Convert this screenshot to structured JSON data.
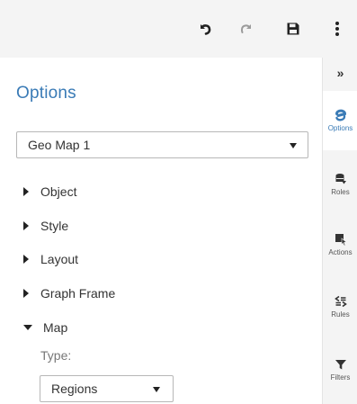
{
  "toolbar": {
    "undo_icon": "undo-icon",
    "redo_icon": "redo-icon",
    "save_icon": "save-icon",
    "more_icon": "more-vertical-icon"
  },
  "panel": {
    "title": "Options",
    "object_select": {
      "value": "Geo Map 1"
    },
    "sections": [
      {
        "label": "Object",
        "expanded": false
      },
      {
        "label": "Style",
        "expanded": false
      },
      {
        "label": "Layout",
        "expanded": false
      },
      {
        "label": "Graph Frame",
        "expanded": false
      },
      {
        "label": "Map",
        "expanded": true
      }
    ],
    "map": {
      "type_label": "Type:",
      "type_value": "Regions"
    }
  },
  "rail": {
    "collapse_label": "»",
    "tabs": [
      {
        "label": "Options",
        "icon": "options-icon",
        "active": true
      },
      {
        "label": "Roles",
        "icon": "roles-icon",
        "active": false
      },
      {
        "label": "Actions",
        "icon": "actions-icon",
        "active": false
      },
      {
        "label": "Rules",
        "icon": "rules-icon",
        "active": false
      },
      {
        "label": "Filters",
        "icon": "filter-icon",
        "active": false
      }
    ]
  },
  "colors": {
    "accent": "#3a7bb6",
    "toolbar_bg": "#f4f4f4",
    "disabled_icon": "#9b9b9b"
  }
}
